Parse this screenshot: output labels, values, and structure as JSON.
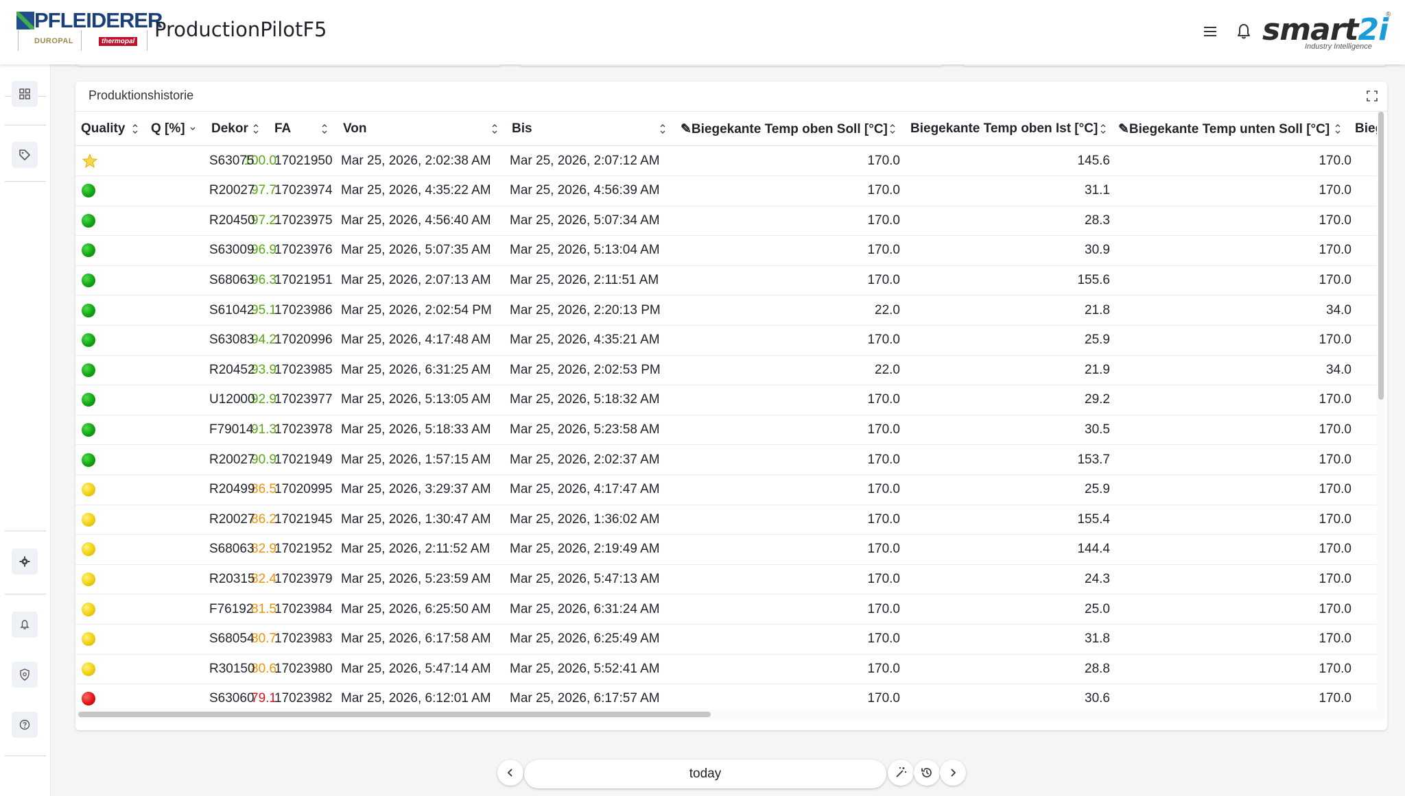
{
  "header": {
    "logo_text": "PFLEIDERER",
    "sub_logo_1": "DUROPAL",
    "sub_logo_2": "thermopal",
    "app_title": "ProductionPilotF5",
    "brand_main": "smart",
    "brand_two": "2i",
    "brand_sub": "Industry Intelligence",
    "brand_reg": "®"
  },
  "sidebar": {
    "items": [
      {
        "icon": "dashboard-grid-icon"
      },
      {
        "icon": "tag-icon"
      },
      {
        "icon": "gear-icon"
      },
      {
        "icon": "bell-icon"
      },
      {
        "icon": "shield-icon"
      },
      {
        "icon": "help-icon"
      }
    ]
  },
  "panel": {
    "title": "Produktionshistorie"
  },
  "table": {
    "columns": [
      "Quality",
      "Q [%]",
      "Dekor",
      "FA",
      "Von",
      "Bis",
      "✎Biegekante Temp oben Soll [°C]",
      "Biegekante Temp oben Ist [°C]",
      "✎Biegekante Temp unten Soll [°C]",
      "Bieg"
    ],
    "rows": [
      {
        "quality": "star",
        "q": "100.0",
        "q_color": "#5aa51a",
        "dekor": "S63075",
        "fa": "17021950",
        "von": "Mar 25, 2026, 2:02:38 AM",
        "bis": "Mar 25, 2026, 2:07:12 AM",
        "oben_soll": "170.0",
        "oben_ist": "145.6",
        "unten_soll": "170.0"
      },
      {
        "quality": "green",
        "q": "97.7",
        "q_color": "#5aa51a",
        "dekor": "R20027",
        "fa": "17023974",
        "von": "Mar 25, 2026, 4:35:22 AM",
        "bis": "Mar 25, 2026, 4:56:39 AM",
        "oben_soll": "170.0",
        "oben_ist": "31.1",
        "unten_soll": "170.0"
      },
      {
        "quality": "green",
        "q": "97.2",
        "q_color": "#5aa51a",
        "dekor": "R20450",
        "fa": "17023975",
        "von": "Mar 25, 2026, 4:56:40 AM",
        "bis": "Mar 25, 2026, 5:07:34 AM",
        "oben_soll": "170.0",
        "oben_ist": "28.3",
        "unten_soll": "170.0"
      },
      {
        "quality": "green",
        "q": "96.9",
        "q_color": "#5aa51a",
        "dekor": "S63009",
        "fa": "17023976",
        "von": "Mar 25, 2026, 5:07:35 AM",
        "bis": "Mar 25, 2026, 5:13:04 AM",
        "oben_soll": "170.0",
        "oben_ist": "30.9",
        "unten_soll": "170.0"
      },
      {
        "quality": "green",
        "q": "96.3",
        "q_color": "#5aa51a",
        "dekor": "S68063",
        "fa": "17021951",
        "von": "Mar 25, 2026, 2:07:13 AM",
        "bis": "Mar 25, 2026, 2:11:51 AM",
        "oben_soll": "170.0",
        "oben_ist": "155.6",
        "unten_soll": "170.0"
      },
      {
        "quality": "green",
        "q": "95.1",
        "q_color": "#5aa51a",
        "dekor": "S61042",
        "fa": "17023986",
        "von": "Mar 25, 2026, 2:02:54 PM",
        "bis": "Mar 25, 2026, 2:20:13 PM",
        "oben_soll": "22.0",
        "oben_ist": "21.8",
        "unten_soll": "34.0"
      },
      {
        "quality": "green",
        "q": "94.2",
        "q_color": "#5aa51a",
        "dekor": "S63083",
        "fa": "17020996",
        "von": "Mar 25, 2026, 4:17:48 AM",
        "bis": "Mar 25, 2026, 4:35:21 AM",
        "oben_soll": "170.0",
        "oben_ist": "25.9",
        "unten_soll": "170.0"
      },
      {
        "quality": "green",
        "q": "93.9",
        "q_color": "#5aa51a",
        "dekor": "R20452",
        "fa": "17023985",
        "von": "Mar 25, 2026, 6:31:25 AM",
        "bis": "Mar 25, 2026, 2:02:53 PM",
        "oben_soll": "22.0",
        "oben_ist": "21.9",
        "unten_soll": "34.0"
      },
      {
        "quality": "green",
        "q": "92.9",
        "q_color": "#5aa51a",
        "dekor": "U12000",
        "fa": "17023977",
        "von": "Mar 25, 2026, 5:13:05 AM",
        "bis": "Mar 25, 2026, 5:18:32 AM",
        "oben_soll": "170.0",
        "oben_ist": "29.2",
        "unten_soll": "170.0"
      },
      {
        "quality": "green",
        "q": "91.3",
        "q_color": "#5aa51a",
        "dekor": "F79014",
        "fa": "17023978",
        "von": "Mar 25, 2026, 5:18:33 AM",
        "bis": "Mar 25, 2026, 5:23:58 AM",
        "oben_soll": "170.0",
        "oben_ist": "30.5",
        "unten_soll": "170.0"
      },
      {
        "quality": "green",
        "q": "90.9",
        "q_color": "#5aa51a",
        "dekor": "R20027",
        "fa": "17021949",
        "von": "Mar 25, 2026, 1:57:15 AM",
        "bis": "Mar 25, 2026, 2:02:37 AM",
        "oben_soll": "170.0",
        "oben_ist": "153.7",
        "unten_soll": "170.0"
      },
      {
        "quality": "yellow",
        "q": "86.5",
        "q_color": "#e8930c",
        "dekor": "R20499",
        "fa": "17020995",
        "von": "Mar 25, 2026, 3:29:37 AM",
        "bis": "Mar 25, 2026, 4:17:47 AM",
        "oben_soll": "170.0",
        "oben_ist": "25.9",
        "unten_soll": "170.0"
      },
      {
        "quality": "yellow",
        "q": "86.2",
        "q_color": "#e8930c",
        "dekor": "R20027",
        "fa": "17021945",
        "von": "Mar 25, 2026, 1:30:47 AM",
        "bis": "Mar 25, 2026, 1:36:02 AM",
        "oben_soll": "170.0",
        "oben_ist": "155.4",
        "unten_soll": "170.0"
      },
      {
        "quality": "yellow",
        "q": "82.9",
        "q_color": "#e8930c",
        "dekor": "S68063",
        "fa": "17021952",
        "von": "Mar 25, 2026, 2:11:52 AM",
        "bis": "Mar 25, 2026, 2:19:49 AM",
        "oben_soll": "170.0",
        "oben_ist": "144.4",
        "unten_soll": "170.0"
      },
      {
        "quality": "yellow",
        "q": "82.4",
        "q_color": "#e8930c",
        "dekor": "R20315",
        "fa": "17023979",
        "von": "Mar 25, 2026, 5:23:59 AM",
        "bis": "Mar 25, 2026, 5:47:13 AM",
        "oben_soll": "170.0",
        "oben_ist": "24.3",
        "unten_soll": "170.0"
      },
      {
        "quality": "yellow",
        "q": "81.5",
        "q_color": "#e8930c",
        "dekor": "F76192",
        "fa": "17023984",
        "von": "Mar 25, 2026, 6:25:50 AM",
        "bis": "Mar 25, 2026, 6:31:24 AM",
        "oben_soll": "170.0",
        "oben_ist": "25.0",
        "unten_soll": "170.0"
      },
      {
        "quality": "yellow",
        "q": "80.7",
        "q_color": "#e8930c",
        "dekor": "S68054",
        "fa": "17023983",
        "von": "Mar 25, 2026, 6:17:58 AM",
        "bis": "Mar 25, 2026, 6:25:49 AM",
        "oben_soll": "170.0",
        "oben_ist": "31.8",
        "unten_soll": "170.0"
      },
      {
        "quality": "yellow",
        "q": "80.6",
        "q_color": "#e8930c",
        "dekor": "R30150",
        "fa": "17023980",
        "von": "Mar 25, 2026, 5:47:14 AM",
        "bis": "Mar 25, 2026, 5:52:41 AM",
        "oben_soll": "170.0",
        "oben_ist": "28.8",
        "unten_soll": "170.0"
      },
      {
        "quality": "red",
        "q": "79.1",
        "q_color": "#d2161d",
        "dekor": "S63060",
        "fa": "17023982",
        "von": "Mar 25, 2026, 6:12:01 AM",
        "bis": "Mar 25, 2026, 6:17:57 AM",
        "oben_soll": "170.0",
        "oben_ist": "30.6",
        "unten_soll": "170.0"
      },
      {
        "quality": "red",
        "q": "",
        "q_color": "#d2161d",
        "dekor": "",
        "fa": "",
        "von": "",
        "bis": "",
        "oben_soll": "",
        "oben_ist": "",
        "unten_soll": ""
      }
    ]
  },
  "footer": {
    "date_label": "today"
  }
}
